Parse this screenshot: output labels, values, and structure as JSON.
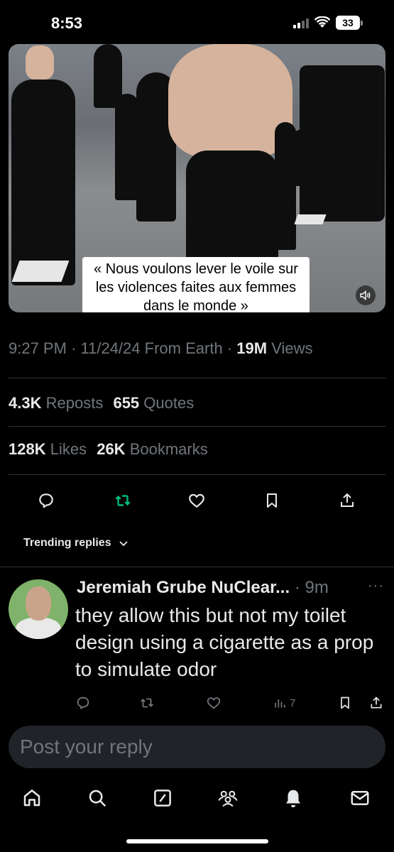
{
  "status_bar": {
    "time": "8:53",
    "battery": "33"
  },
  "media": {
    "caption": "« Nous voulons lever le voile sur les violences faites aux femmes dans le monde »",
    "mute_icon": "speaker-icon"
  },
  "tweet_meta": {
    "time": "9:27 PM",
    "date": "11/24/24",
    "source": "From Earth",
    "views_count": "19M",
    "views_label": "Views"
  },
  "stats": {
    "reposts_count": "4.3K",
    "reposts_label": "Reposts",
    "quotes_count": "655",
    "quotes_label": "Quotes",
    "likes_count": "128K",
    "likes_label": "Likes",
    "bookmarks_count": "26K",
    "bookmarks_label": "Bookmarks"
  },
  "actions": [
    "reply-icon",
    "repost-icon",
    "like-icon",
    "bookmark-icon",
    "share-icon"
  ],
  "colors": {
    "repost_active": "#00ba7c",
    "muted_text": "#71767b",
    "primary_text": "#e7e9ea"
  },
  "trending": {
    "label": "Trending replies"
  },
  "reply": {
    "author": "Jeremiah Grube NuClear...",
    "time": "9m",
    "text": "they allow this but not my toilet design using a cigarette as a prop to simulate odor",
    "views_count": "7"
  },
  "composer": {
    "placeholder": "Post your reply"
  },
  "tabbar": [
    "home-icon",
    "search-icon",
    "grok-icon",
    "communities-icon",
    "notifications-icon",
    "messages-icon"
  ]
}
